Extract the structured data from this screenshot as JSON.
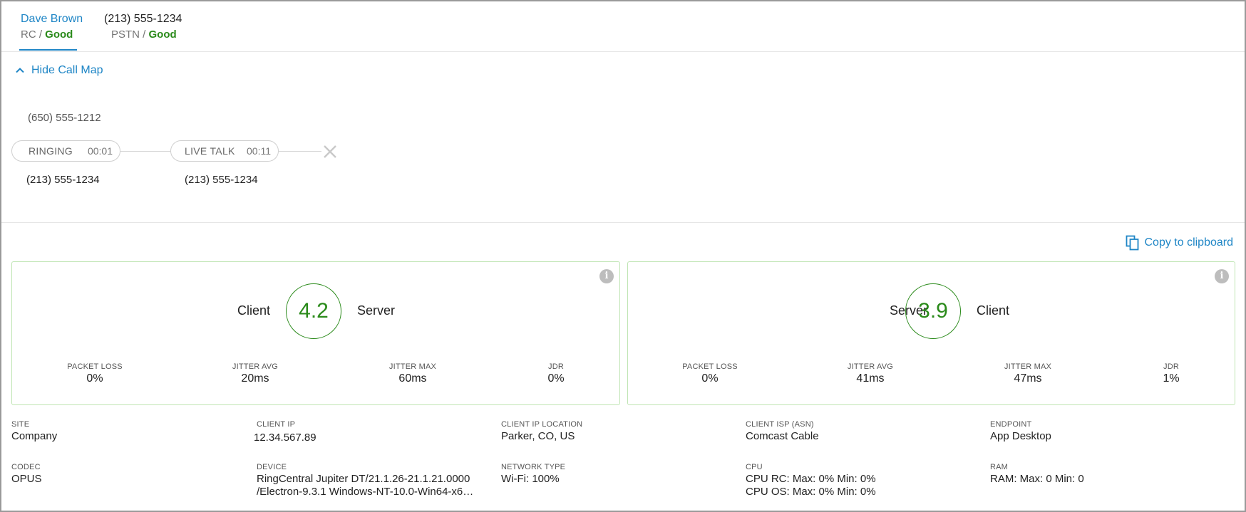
{
  "tabs": [
    {
      "name": "Dave Brown",
      "status_prefix": "RC / ",
      "status_value": "Good",
      "active": true
    },
    {
      "name": "(213) 555-1234",
      "status_prefix": "PSTN / ",
      "status_value": "Good",
      "active": false
    }
  ],
  "call_map": {
    "toggle_label": "Hide Call Map",
    "caller": "(650) 555-1212",
    "segments": [
      {
        "state": "RINGING",
        "duration": "00:01",
        "party": "(213) 555-1234"
      },
      {
        "state": "LIVE TALK",
        "duration": "00:11",
        "party": "(213) 555-1234"
      }
    ],
    "end_icon": "close-icon"
  },
  "copy_label": "Copy to clipboard",
  "quality": [
    {
      "left_label": "Client",
      "score": "4.2",
      "right_label": "Server",
      "metrics": [
        {
          "key": "PACKET LOSS",
          "value": "0%"
        },
        {
          "key": "JITTER AVG",
          "value": "20ms"
        },
        {
          "key": "JITTER MAX",
          "value": "60ms"
        },
        {
          "key": "JDR",
          "value": "0%"
        }
      ]
    },
    {
      "left_label": "Server",
      "score": "3.9",
      "right_label": "Client",
      "metrics": [
        {
          "key": "PACKET LOSS",
          "value": "0%"
        },
        {
          "key": "JITTER AVG",
          "value": "41ms"
        },
        {
          "key": "JITTER MAX",
          "value": "47ms"
        },
        {
          "key": "JDR",
          "value": "1%"
        }
      ]
    }
  ],
  "details": {
    "site": {
      "key": "SITE",
      "value": "Company"
    },
    "client_ip": {
      "key": "CLIENT IP",
      "value": "12.34.567.89"
    },
    "client_ip_location": {
      "key": "CLIENT IP LOCATION",
      "value": "Parker, CO, US"
    },
    "client_isp": {
      "key": "CLIENT ISP (ASN)",
      "value": "Comcast Cable"
    },
    "endpoint": {
      "key": "ENDPOINT",
      "value": "App Desktop"
    },
    "codec": {
      "key": "CODEC",
      "value": "OPUS"
    },
    "device": {
      "key": "DEVICE",
      "line1": "RingCentral Jupiter DT/21.1.26-21.1.21.0000",
      "line2": "/Electron-9.3.1 Windows-NT-10.0-Win64-x64..."
    },
    "network_type": {
      "key": "NETWORK TYPE",
      "value": "Wi-Fi: 100%"
    },
    "cpu": {
      "key": "CPU",
      "line1": "CPU RC: Max: 0% Min: 0%",
      "line2": "CPU OS: Max: 0% Min: 0%"
    },
    "ram": {
      "key": "RAM",
      "value": "RAM: Max: 0 Min: 0"
    }
  },
  "colors": {
    "accent": "#1f86c6",
    "good": "#2a8a1a",
    "card_border": "#bfe5b3"
  }
}
